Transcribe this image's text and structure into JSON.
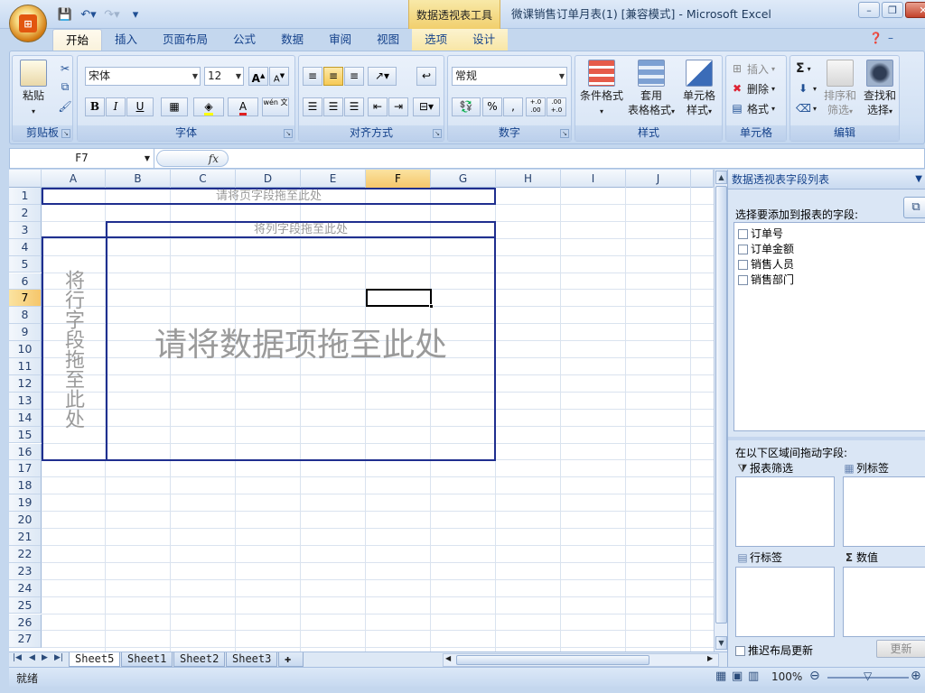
{
  "titlebar": {
    "context_tab": "数据透视表工具",
    "window_title": "微课销售订单月表(1)  [兼容模式] - Microsoft Excel"
  },
  "tabs": [
    "开始",
    "插入",
    "页面布局",
    "公式",
    "数据",
    "审阅",
    "视图",
    "选项",
    "设计"
  ],
  "ribbon": {
    "clipboard": {
      "label": "剪贴板",
      "paste": "粘贴"
    },
    "font": {
      "label": "字体",
      "name": "宋体",
      "size": "12",
      "bold": "B",
      "italic": "I",
      "underline": "U",
      "grow": "A",
      "shrink": "A",
      "phonetic": "wén 文"
    },
    "alignment": {
      "label": "对齐方式"
    },
    "number": {
      "label": "数字",
      "format": "常规",
      "percent": "%",
      "comma": ",",
      "inc_decimal": "+.0 .00",
      "dec_decimal": ".00 +.0"
    },
    "styles": {
      "label": "样式",
      "conditional": "条件格式",
      "table_format_1": "套用",
      "table_format_2": "表格格式",
      "cell_style_1": "单元格",
      "cell_style_2": "样式"
    },
    "cells": {
      "label": "单元格",
      "insert": "插入",
      "delete": "删除",
      "format": "格式"
    },
    "editing": {
      "label": "编辑",
      "sum": "Σ",
      "sort_1": "排序和",
      "sort_2": "筛选",
      "find_1": "查找和",
      "find_2": "选择"
    }
  },
  "formula_bar": {
    "name_box": "F7",
    "fx": "fx"
  },
  "grid": {
    "columns": [
      "A",
      "B",
      "C",
      "D",
      "E",
      "F",
      "G",
      "H",
      "I",
      "J"
    ],
    "rows": [
      "1",
      "2",
      "3",
      "4",
      "5",
      "6",
      "7",
      "8",
      "9",
      "10",
      "11",
      "12",
      "13",
      "14",
      "15",
      "16",
      "17",
      "18",
      "19",
      "20",
      "21",
      "22",
      "23",
      "24",
      "25",
      "26",
      "27"
    ],
    "selected_col": "F",
    "selected_row": "7",
    "page_field_drop": "请将页字段拖至此处",
    "col_field_drop": "将列字段拖至此处",
    "row_field_drop": "将行字段拖至此处",
    "data_drop": "请将数据项拖至此处"
  },
  "sheet_tabs": [
    "Sheet5",
    "Sheet1",
    "Sheet2",
    "Sheet3"
  ],
  "active_sheet": "Sheet5",
  "status": {
    "ready": "就绪",
    "zoom": "100%"
  },
  "pivot_panel": {
    "title": "数据透视表字段列表",
    "choose_label": "选择要添加到报表的字段:",
    "fields": [
      "订单号",
      "订单金额",
      "销售人员",
      "销售部门"
    ],
    "drag_label": "在以下区域间拖动字段:",
    "report_filter": "报表筛选",
    "column_labels": "列标签",
    "row_labels": "行标签",
    "values": "数值",
    "defer_label": "推迟布局更新",
    "update_button": "更新"
  }
}
